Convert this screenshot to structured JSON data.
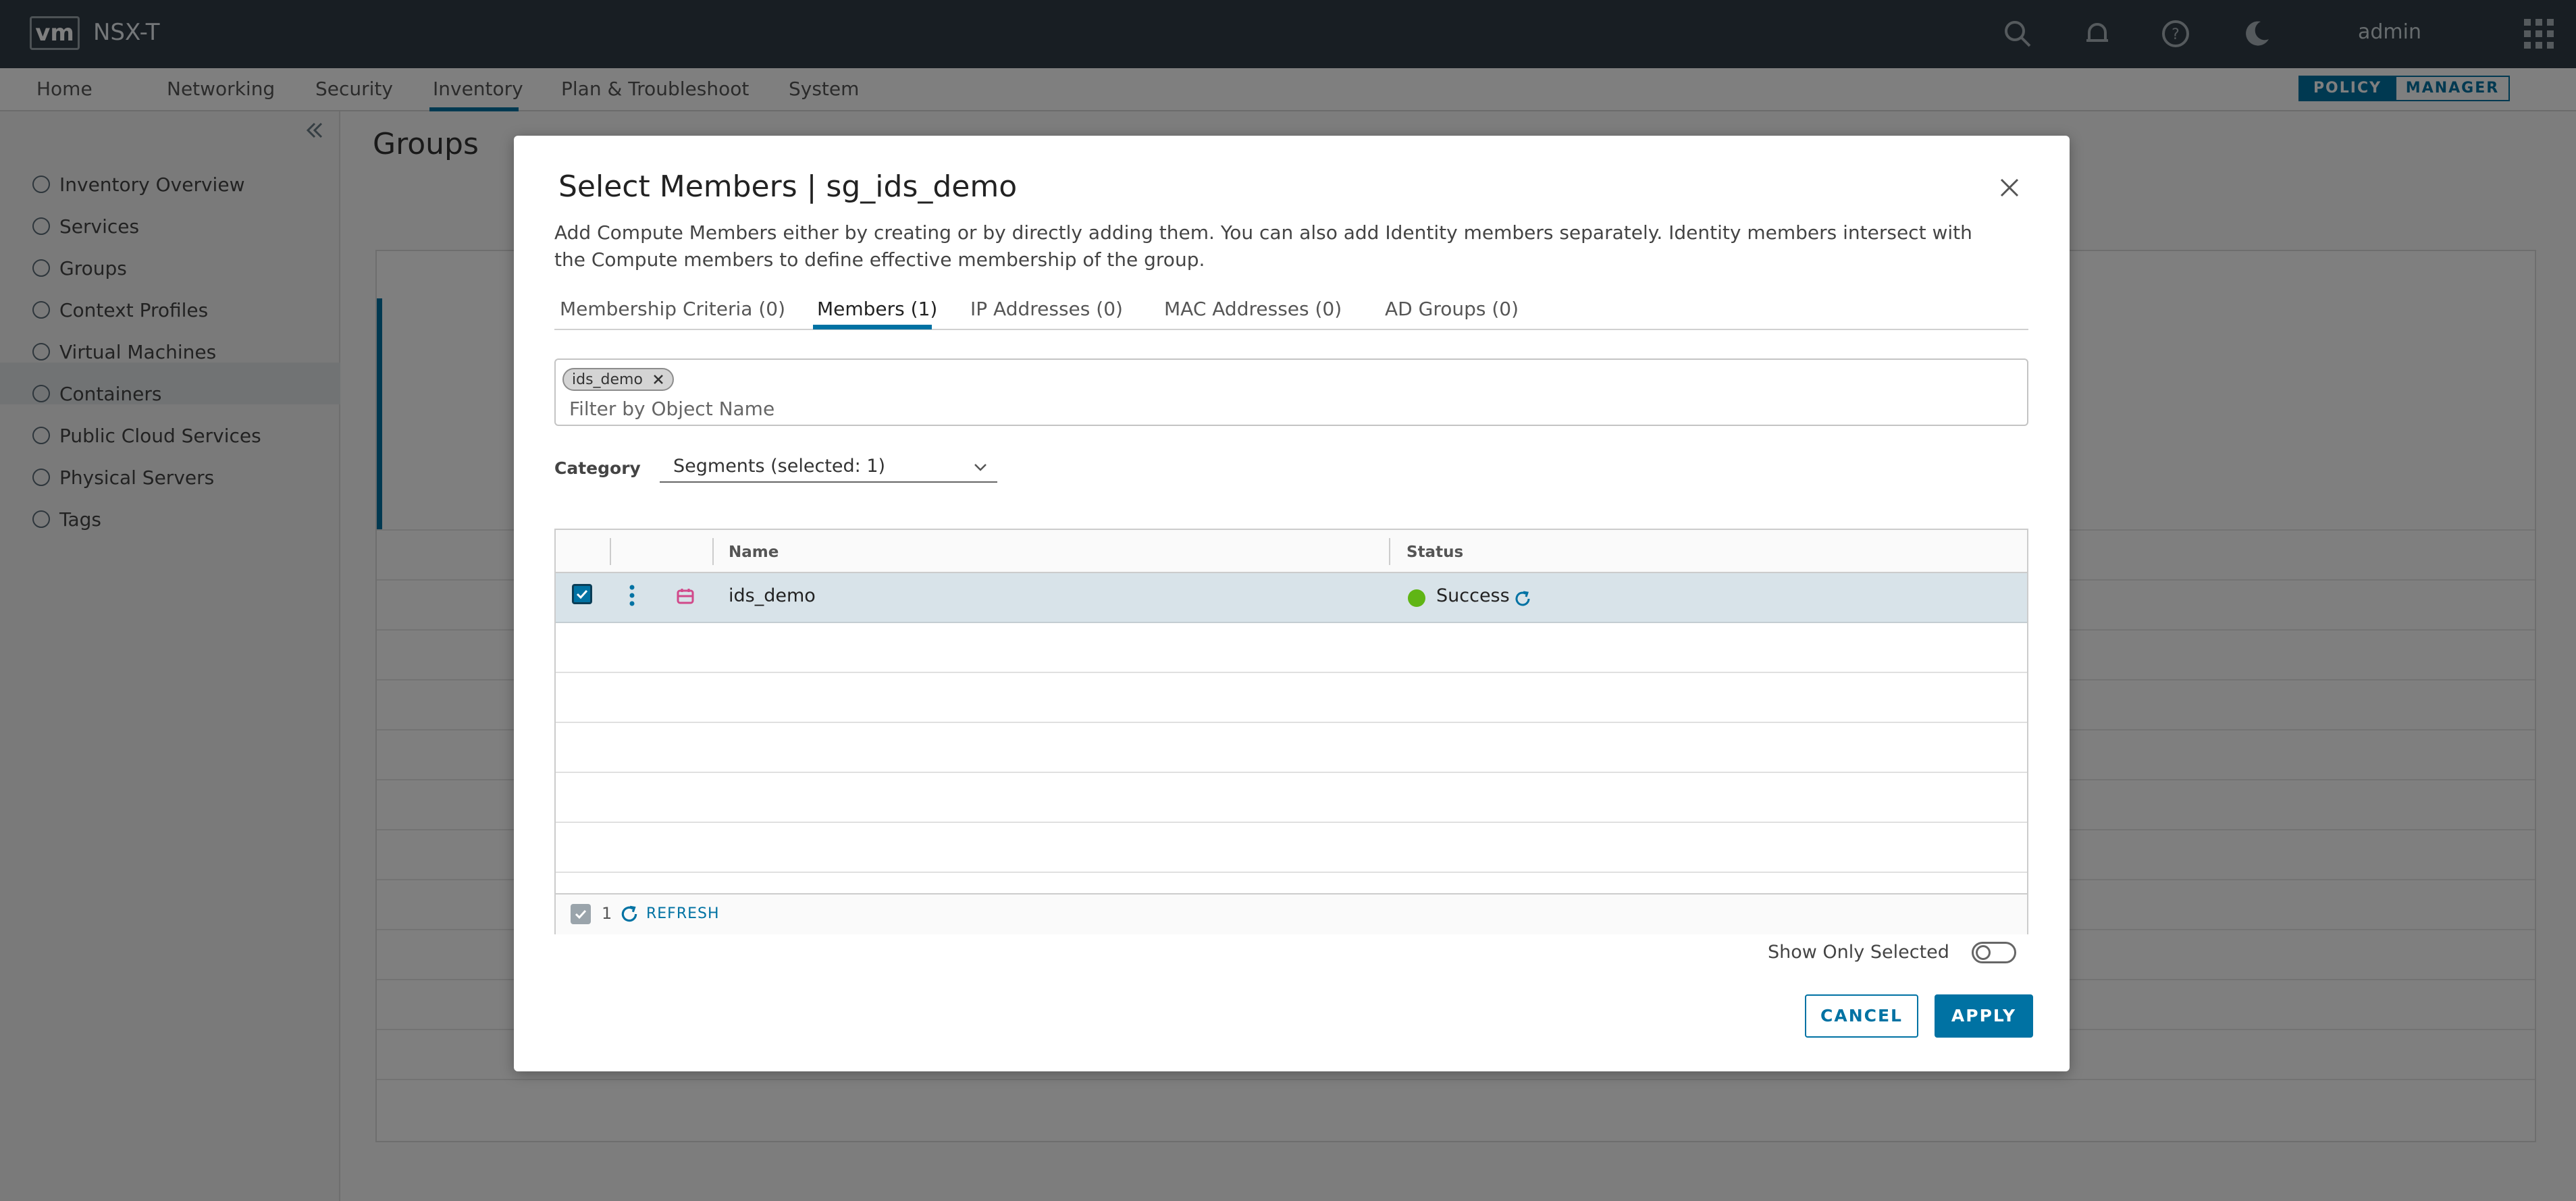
{
  "app": {
    "logo": "vm",
    "title": "NSX-T",
    "user": "admin"
  },
  "nav": {
    "items": [
      "Home",
      "Networking",
      "Security",
      "Inventory",
      "Plan & Troubleshoot",
      "System"
    ],
    "modes": [
      "POLICY",
      "MANAGER"
    ]
  },
  "sidebar": {
    "items": [
      "Inventory Overview",
      "Services",
      "Groups",
      "Context Profiles",
      "Virtual Machines",
      "Containers",
      "Public Cloud Services",
      "Physical Servers",
      "Tags"
    ]
  },
  "page": {
    "title": "Groups"
  },
  "modal": {
    "title": "Select Members | sg_ids_demo",
    "description": "Add Compute Members either by creating or by directly adding them. You can also add Identity members separately. Identity members intersect with the Compute members to define effective membership of the group.",
    "tabs": [
      "Membership Criteria (0)",
      "Members (1)",
      "IP Addresses (0)",
      "MAC Addresses (0)",
      "AD Groups (0)"
    ],
    "chip": "ids_demo",
    "filter_placeholder": "Filter by Object Name",
    "category_label": "Category",
    "category_value": "Segments (selected: 1)",
    "columns": {
      "name": "Name",
      "status": "Status"
    },
    "row": {
      "name": "ids_demo",
      "status": "Success"
    },
    "footer": {
      "count": "1",
      "refresh": "REFRESH"
    },
    "show_only_selected": "Show Only Selected",
    "cancel": "CANCEL",
    "apply": "APPLY"
  },
  "colors": {
    "accent": "#0072a3",
    "success": "#60b515",
    "header": "#313d47"
  }
}
